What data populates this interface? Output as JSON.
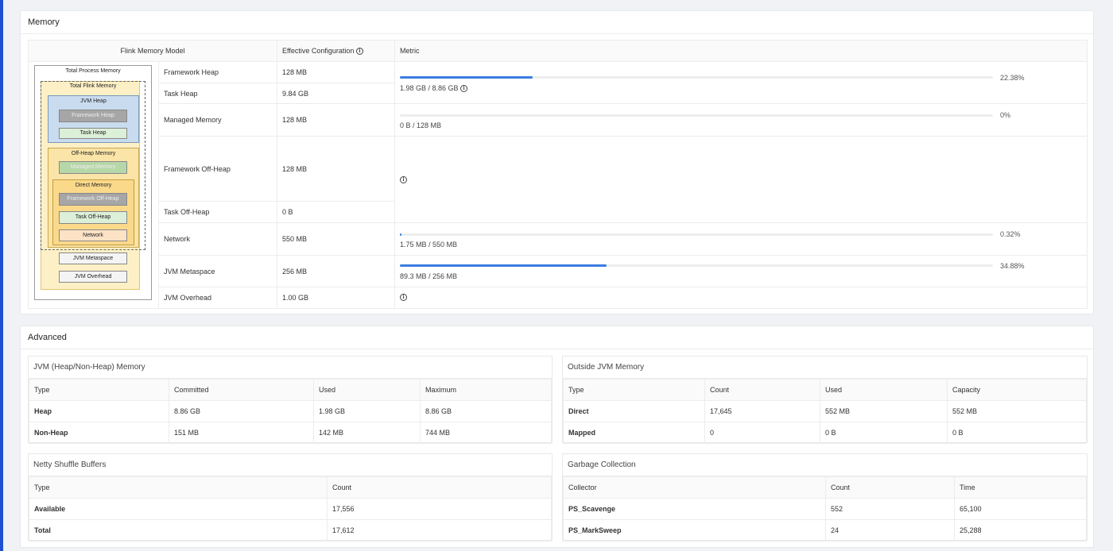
{
  "memory": {
    "title": "Memory",
    "columns": {
      "model": "Flink Memory Model",
      "config": "Effective Configuration",
      "metric": "Metric"
    },
    "diagram": {
      "total_process": "Total Process Memory",
      "total_flink": "Total Flink Memory",
      "jvm_heap": "JVM Heap",
      "framework_heap": "Framework Heap",
      "task_heap": "Task Heap",
      "off_heap": "Off-Heap Memory",
      "managed": "Managed Memory",
      "direct": "Direct Memory",
      "framework_off_heap": "Framework Off-Heap",
      "task_off_heap": "Task Off-Heap",
      "network": "Network",
      "jvm_metaspace": "JVM Metaspace",
      "jvm_overhead": "JVM Overhead"
    },
    "rows": {
      "framework_heap": {
        "label": "Framework Heap",
        "value": "128 MB"
      },
      "task_heap": {
        "label": "Task Heap",
        "value": "9.84 GB"
      },
      "managed": {
        "label": "Managed Memory",
        "value": "128 MB"
      },
      "framework_off_heap": {
        "label": "Framework Off-Heap",
        "value": "128 MB"
      },
      "task_off_heap": {
        "label": "Task Off-Heap",
        "value": "0 B"
      },
      "network": {
        "label": "Network",
        "value": "550 MB"
      },
      "jvm_metaspace": {
        "label": "JVM Metaspace",
        "value": "256 MB"
      },
      "jvm_overhead": {
        "label": "JVM Overhead",
        "value": "1.00 GB"
      }
    },
    "metrics": {
      "heap": {
        "percent_label": "22.38%",
        "fraction": 0.2238,
        "text": "1.98 GB / 8.86 GB"
      },
      "managed": {
        "percent_label": "0%",
        "fraction": 0.0,
        "text": "0 B / 128 MB"
      },
      "network": {
        "percent_label": "0.32%",
        "fraction": 0.0032,
        "text": "1.75 MB / 550 MB"
      },
      "metaspace": {
        "percent_label": "34.88%",
        "fraction": 0.3488,
        "text": "89.3 MB / 256 MB"
      }
    },
    "colors": {
      "bar_fill": "#3a7ce0",
      "bar_track": "#ededed"
    }
  },
  "advanced": {
    "title": "Advanced",
    "jvm": {
      "title": "JVM (Heap/Non-Heap) Memory",
      "headers": [
        "Type",
        "Committed",
        "Used",
        "Maximum"
      ],
      "rows": [
        [
          "Heap",
          "8.86 GB",
          "1.98 GB",
          "8.86 GB"
        ],
        [
          "Non-Heap",
          "151 MB",
          "142 MB",
          "744 MB"
        ]
      ]
    },
    "outside": {
      "title": "Outside JVM Memory",
      "headers": [
        "Type",
        "Count",
        "Used",
        "Capacity"
      ],
      "rows": [
        [
          "Direct",
          "17,645",
          "552 MB",
          "552 MB"
        ],
        [
          "Mapped",
          "0",
          "0 B",
          "0 B"
        ]
      ]
    },
    "netty": {
      "title": "Netty Shuffle Buffers",
      "headers": [
        "Type",
        "Count"
      ],
      "rows": [
        [
          "Available",
          "17,556"
        ],
        [
          "Total",
          "17,612"
        ]
      ]
    },
    "gc": {
      "title": "Garbage Collection",
      "headers": [
        "Collector",
        "Count",
        "Time"
      ],
      "rows": [
        [
          "PS_Scavenge",
          "552",
          "65,100"
        ],
        [
          "PS_MarkSweep",
          "24",
          "25,288"
        ]
      ]
    }
  }
}
